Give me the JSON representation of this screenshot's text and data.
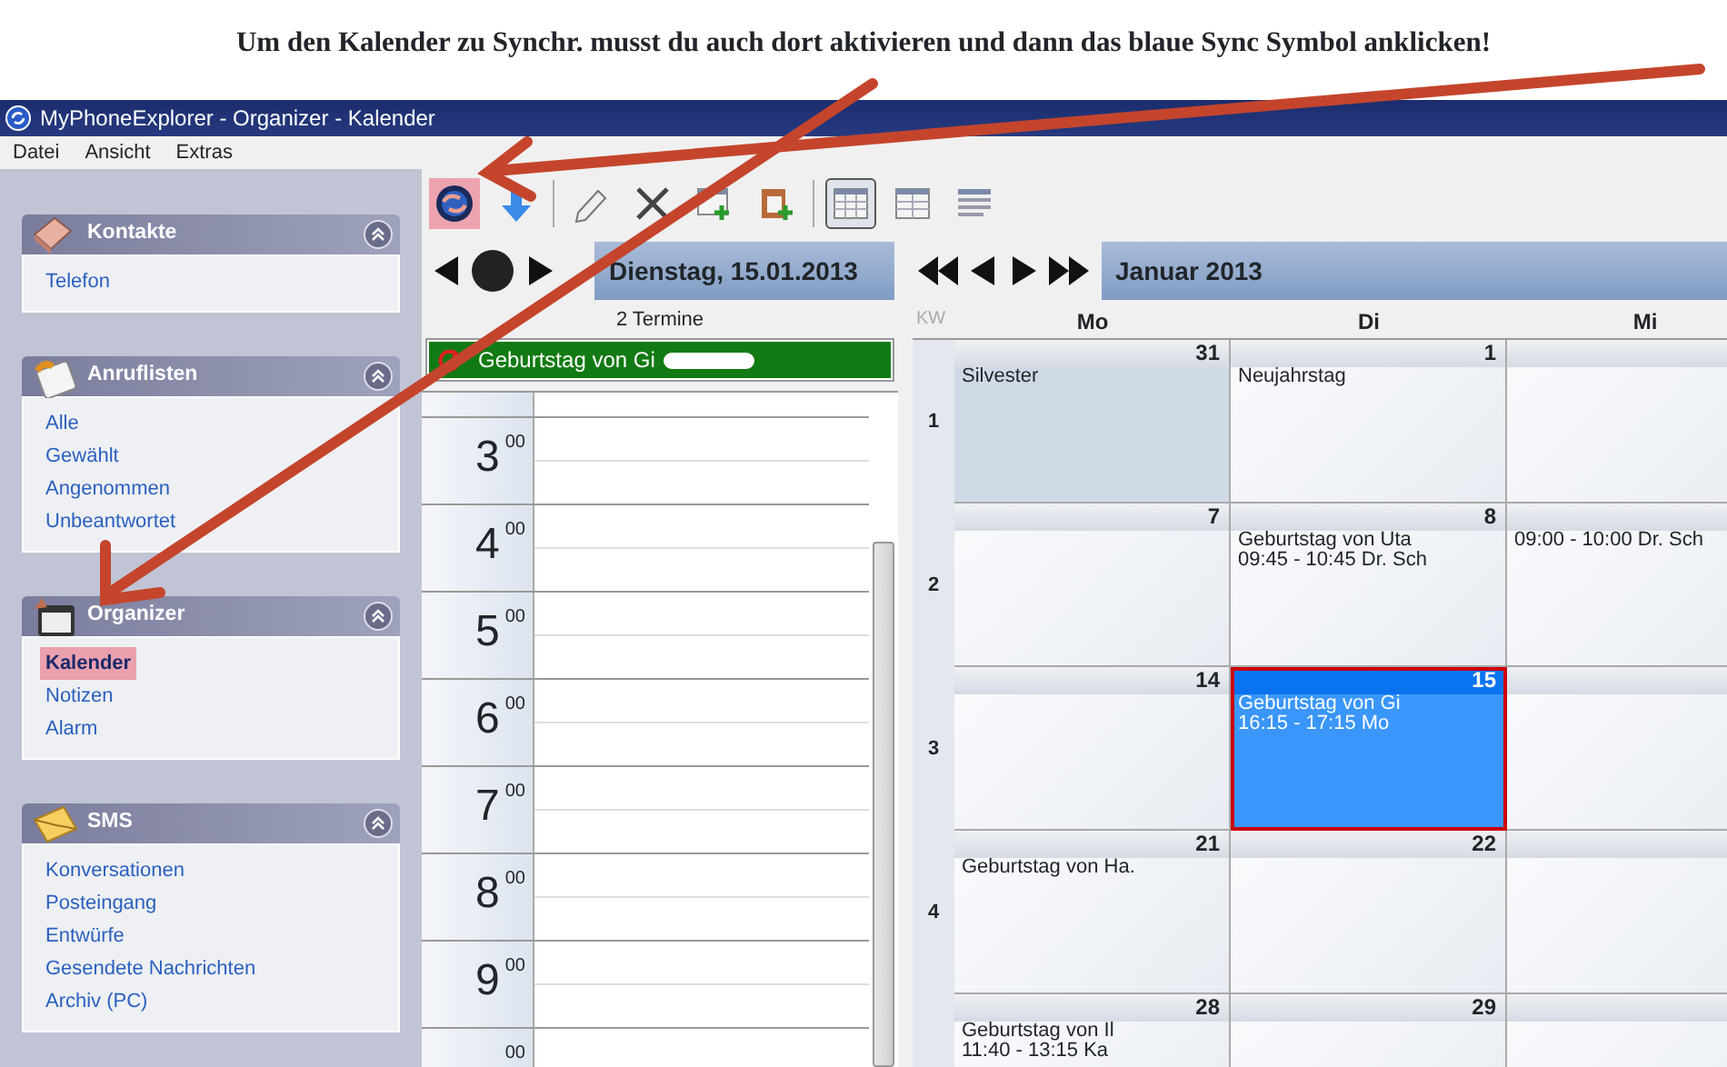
{
  "caption": "Um den Kalender zu Synchr. musst du auch dort aktivieren und dann das blaue Sync Symbol anklicken!",
  "window": {
    "title": "MyPhoneExplorer -  Organizer - Kalender"
  },
  "menu": [
    "Datei",
    "Ansicht",
    "Extras"
  ],
  "toolbar": {
    "actions": [
      {
        "kind": "sync",
        "highlighted": true
      },
      {
        "kind": "download",
        "highlighted": false
      },
      {
        "kind": "edit",
        "highlighted": false
      },
      {
        "kind": "delete",
        "highlighted": false
      },
      {
        "kind": "new-event",
        "highlighted": false
      },
      {
        "kind": "paste",
        "highlighted": false
      }
    ],
    "views": [
      {
        "kind": "month",
        "selected": true
      },
      {
        "kind": "week",
        "selected": false
      },
      {
        "kind": "list",
        "selected": false
      }
    ]
  },
  "sidebar": {
    "groups": [
      {
        "title": "Kontakte",
        "items": [
          {
            "label": "Telefon",
            "selected": false
          }
        ]
      },
      {
        "title": "Anruflisten",
        "items": [
          {
            "label": "Alle",
            "selected": false
          },
          {
            "label": "Gewählt",
            "selected": false
          },
          {
            "label": "Angenommen",
            "selected": false
          },
          {
            "label": "Unbeantwortet",
            "selected": false
          }
        ]
      },
      {
        "title": "Organizer",
        "items": [
          {
            "label": "Kalender",
            "selected": true
          },
          {
            "label": "Notizen",
            "selected": false
          },
          {
            "label": "Alarm",
            "selected": false
          }
        ]
      },
      {
        "title": "SMS",
        "items": [
          {
            "label": "Konversationen",
            "selected": false
          },
          {
            "label": "Posteingang",
            "selected": false
          },
          {
            "label": "Entwürfe",
            "selected": false
          },
          {
            "label": "Gesendete Nachrichten",
            "selected": false
          },
          {
            "label": "Archiv (PC)",
            "selected": false
          }
        ]
      }
    ]
  },
  "day_view": {
    "date": "Dienstag, 15.01.2013",
    "count": "2 Termine",
    "all_day_events": [
      {
        "title": "Geburtstag von Gi",
        "recurring": true
      }
    ],
    "hours": [
      {
        "hour": "3",
        "minutes": "00"
      },
      {
        "hour": "4",
        "minutes": "00"
      },
      {
        "hour": "5",
        "minutes": "00"
      },
      {
        "hour": "6",
        "minutes": "00"
      },
      {
        "hour": "7",
        "minutes": "00"
      },
      {
        "hour": "8",
        "minutes": "00"
      },
      {
        "hour": "9",
        "minutes": "00"
      },
      {
        "minutes": "00"
      }
    ]
  },
  "month_view": {
    "month": "Januar 2013",
    "kw_label": "KW",
    "weekdays": [
      "Mo",
      "Di",
      "Mi"
    ],
    "weeks": [
      {
        "kw": "1",
        "days": [
          {
            "day": "31",
            "outside_month": true,
            "selected": false,
            "events": [
              "Silvester"
            ]
          },
          {
            "day": "1",
            "outside_month": false,
            "selected": false,
            "events": [
              "Neujahrstag"
            ]
          },
          {
            "outside_month": false,
            "selected": false
          }
        ]
      },
      {
        "kw": "2",
        "days": [
          {
            "day": "7",
            "outside_month": false,
            "selected": false
          },
          {
            "day": "8",
            "outside_month": false,
            "selected": false,
            "events": [
              "Geburtstag von Uta",
              "09:45 - 10:45 Dr. Sch"
            ]
          },
          {
            "outside_month": false,
            "selected": false,
            "events": [
              "09:00 - 10:00 Dr. Sch"
            ]
          }
        ]
      },
      {
        "kw": "3",
        "days": [
          {
            "day": "14",
            "outside_month": false,
            "selected": false
          },
          {
            "day": "15",
            "outside_month": false,
            "selected": true,
            "events": [
              "Geburtstag von Gi",
              "16:15 - 17:15 Mo"
            ]
          },
          {
            "outside_month": false,
            "selected": false
          }
        ]
      },
      {
        "kw": "4",
        "days": [
          {
            "day": "21",
            "outside_month": false,
            "selected": false,
            "events": [
              "Geburtstag von Ha."
            ]
          },
          {
            "day": "22",
            "outside_month": false,
            "selected": false
          },
          {
            "outside_month": false,
            "selected": false
          }
        ]
      },
      {
        "days": [
          {
            "day": "28",
            "outside_month": false,
            "selected": false,
            "events": [
              "Geburtstag von Il",
              "11:40 - 13:15 Ka"
            ]
          },
          {
            "day": "29",
            "outside_month": false,
            "selected": false
          },
          {
            "outside_month": false,
            "selected": false
          }
        ]
      }
    ]
  }
}
